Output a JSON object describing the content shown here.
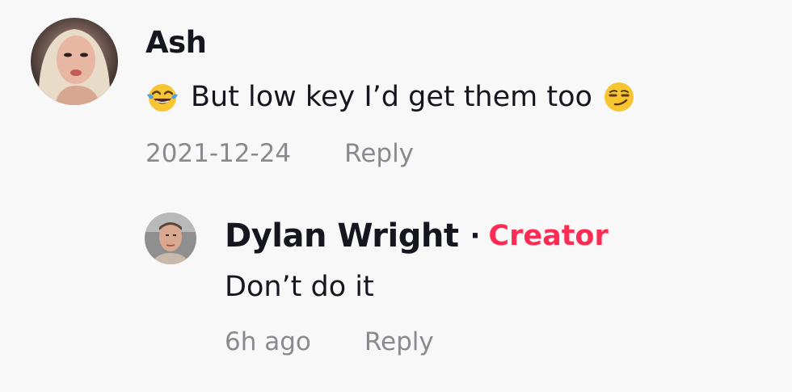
{
  "comments": [
    {
      "author": "Ash",
      "text": "But low key I’d get them too",
      "leading_emoji": "face-with-tears-of-joy-icon",
      "trailing_emoji": "smirking-face-icon",
      "date": "2021-12-24",
      "reply_label": "Reply"
    }
  ],
  "reply": {
    "author": "Dylan Wright",
    "separator": "·",
    "badge": "Creator",
    "text": "Don’t do it",
    "time": "6h ago",
    "reply_label": "Reply"
  },
  "colors": {
    "background": "#f8f8f8",
    "text": "#16161e",
    "meta": "#8a8a8e",
    "creator": "#fe2c55"
  }
}
